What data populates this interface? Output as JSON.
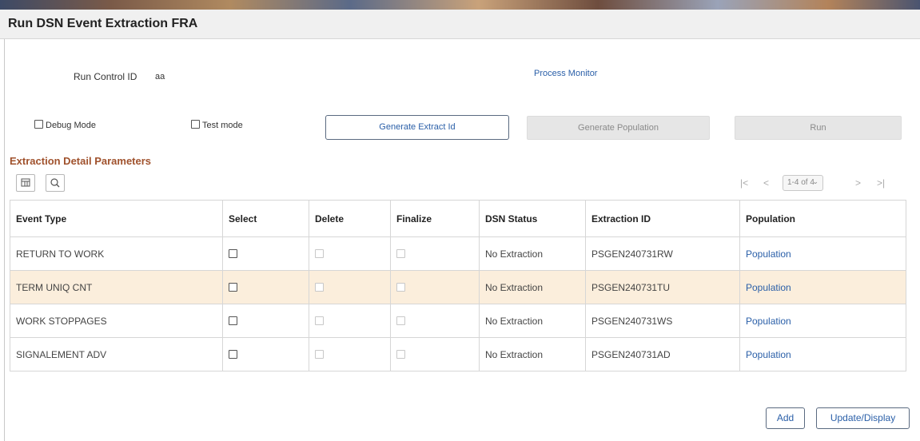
{
  "page": {
    "title": "Run DSN Event Extraction FRA"
  },
  "run_control": {
    "label": "Run Control ID",
    "value": "aa",
    "process_monitor": "Process Monitor"
  },
  "options": {
    "debug_mode": "Debug Mode",
    "test_mode": "Test mode"
  },
  "actions": {
    "generate_extract_id": "Generate Extract Id",
    "generate_population": "Generate Population",
    "run": "Run"
  },
  "section": {
    "title": "Extraction Detail Parameters"
  },
  "pager": {
    "first": "|<",
    "prev": "<",
    "range": "1-4 of 4",
    "next": ">",
    "last": ">|"
  },
  "grid": {
    "columns": [
      "Event Type",
      "Select",
      "Delete",
      "Finalize",
      "DSN Status",
      "Extraction ID",
      "Population"
    ],
    "rows": [
      {
        "event_type": "RETURN TO WORK",
        "dsn_status": "No Extraction",
        "extraction_id": "PSGEN240731RW",
        "population": "Population"
      },
      {
        "event_type": "TERM UNIQ CNT",
        "dsn_status": "No Extraction",
        "extraction_id": "PSGEN240731TU",
        "population": "Population"
      },
      {
        "event_type": "WORK STOPPAGES",
        "dsn_status": "No Extraction",
        "extraction_id": "PSGEN240731WS",
        "population": "Population"
      },
      {
        "event_type": "SIGNALEMENT ADV",
        "dsn_status": "No Extraction",
        "extraction_id": "PSGEN240731AD",
        "population": "Population"
      }
    ]
  },
  "footer": {
    "add": "Add",
    "update_display": "Update/Display"
  },
  "icons": {
    "grid_personalize": "grid-personalize-icon",
    "search": "search-icon"
  },
  "colors": {
    "section_title": "#a0522d",
    "link": "#2a5fa8",
    "highlight_row": "#fbeedc"
  }
}
